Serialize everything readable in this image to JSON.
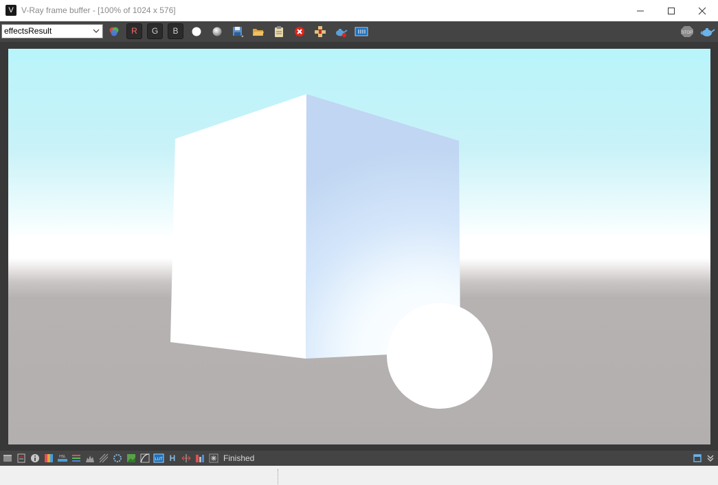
{
  "window": {
    "title": "V-Ray frame buffer - [100% of 1024 x 576]",
    "app_icon_glyph": "V",
    "controls": [
      "minimize",
      "maximize",
      "close"
    ]
  },
  "toolbar": {
    "channel_select": {
      "value": "effectsResult"
    },
    "channels": {
      "r": "R",
      "g": "G",
      "b": "B"
    },
    "icons": [
      "color-mode-icon",
      "white-dot-icon",
      "gray-dot-icon",
      "save-icon",
      "open-icon",
      "clipboard-icon",
      "clear-icon",
      "region-icon",
      "teapot-render-icon",
      "film-icon",
      "stop-icon",
      "teapot-icon"
    ]
  },
  "render": {
    "sky_top": "#b9f4fb",
    "ground": "#b3afaf"
  },
  "statusbar": {
    "status": "Finished",
    "glyph_h": "H",
    "icons": [
      "panel-icon",
      "history-icon",
      "info-icon",
      "lens-icon",
      "hsl-icon",
      "levels-icon",
      "histogram-icon",
      "exposure-icon",
      "denoise-icon",
      "image-icon",
      "curve-icon",
      "lut-icon",
      "h-icon",
      "compare-icon",
      "bars-icon",
      "asterisk-icon",
      "window-icon",
      "chevron-down-icon"
    ]
  },
  "colors": {
    "toolbar_bg": "#444444",
    "frame_bg": "#383838",
    "accent_red": "#e0251b"
  }
}
